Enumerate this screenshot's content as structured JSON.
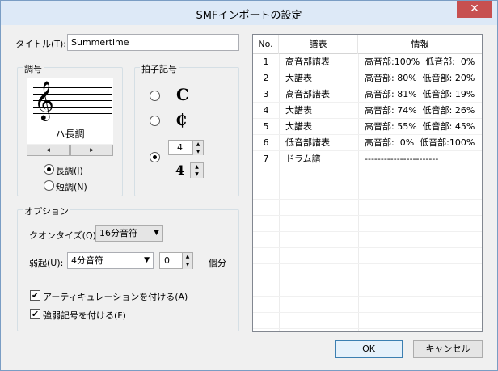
{
  "window": {
    "title": "SMFインポートの設定",
    "close_symbol": "✕"
  },
  "title_field": {
    "label": "タイトル(T):",
    "value": "Summertime"
  },
  "key": {
    "group_label": "調号",
    "key_name": "ハ長調",
    "prev_symbol": "◂",
    "next_symbol": "▸",
    "major_label": "長調(J)",
    "minor_label": "短調(N)",
    "selected": "major"
  },
  "time_signature": {
    "group_label": "拍子記号",
    "common_symbol": "C",
    "cut_symbol": "₵",
    "numerator": "4",
    "denominator": "4",
    "selected": "numeric"
  },
  "options": {
    "group_label": "オプション",
    "quantize_label": "クオンタイズ(Q):",
    "quantize_value": "16分音符",
    "pickup_label": "弱起(U):",
    "pickup_value": "4分音符",
    "pickup_count": "0",
    "pickup_unit": "個分",
    "articulation_label": "アーティキュレーションを付ける(A)",
    "articulation_checked": true,
    "dynamics_label": "強弱記号を付ける(F)",
    "dynamics_checked": true
  },
  "table": {
    "headers": [
      "No.",
      "譜表",
      "情報"
    ],
    "rows": [
      {
        "no": "1",
        "staff": "高音部譜表",
        "info": "高音部:100%  低音部:  0%"
      },
      {
        "no": "2",
        "staff": "大譜表",
        "info": "高音部: 80%  低音部: 20%"
      },
      {
        "no": "3",
        "staff": "高音部譜表",
        "info": "高音部: 81%  低音部: 19%"
      },
      {
        "no": "4",
        "staff": "大譜表",
        "info": "高音部: 74%  低音部: 26%"
      },
      {
        "no": "5",
        "staff": "大譜表",
        "info": "高音部: 55%  低音部: 45%"
      },
      {
        "no": "6",
        "staff": "低音部譜表",
        "info": "高音部:  0%  低音部:100%"
      },
      {
        "no": "7",
        "staff": "ドラム譜",
        "info": "-----------------------"
      }
    ]
  },
  "buttons": {
    "ok": "OK",
    "cancel": "キャンセル"
  }
}
